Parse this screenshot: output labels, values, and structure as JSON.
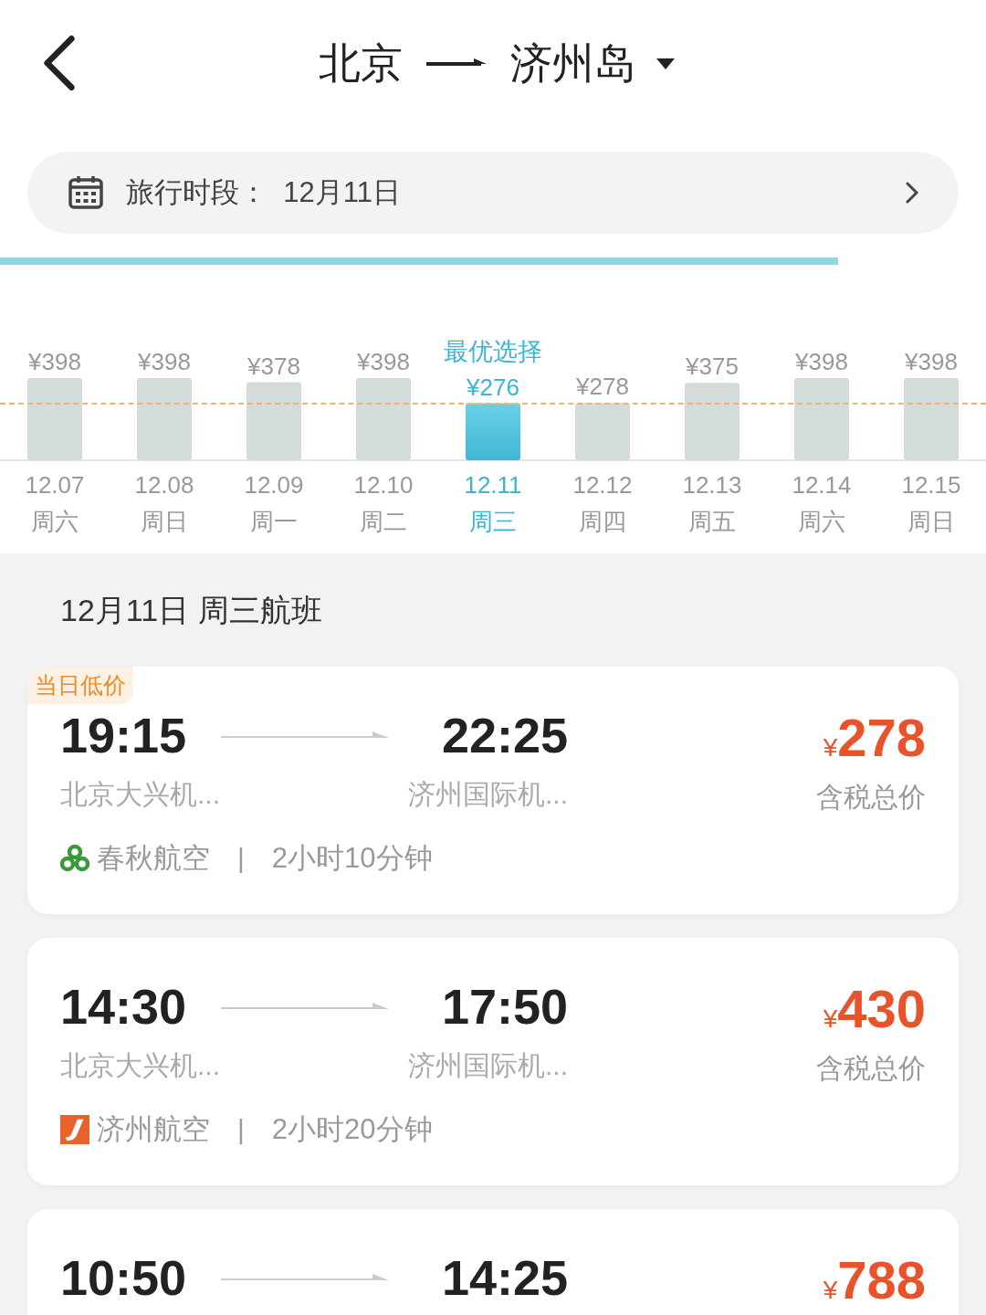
{
  "header": {
    "origin": "北京",
    "destination": "济州岛"
  },
  "date_bar": {
    "label": "旅行时段：",
    "value": "12月11日"
  },
  "loading": {
    "level": 0.85
  },
  "calendar": {
    "chart_data": {
      "type": "bar",
      "categories": [
        "12.07",
        "12.08",
        "12.09",
        "12.10",
        "12.11",
        "12.12",
        "12.13",
        "12.14",
        "12.15"
      ],
      "values": [
        398,
        398,
        378,
        398,
        276,
        278,
        375,
        398,
        398
      ],
      "value_labels": [
        "¥398",
        "¥398",
        "¥378",
        "¥398",
        "¥276",
        "¥278",
        "¥375",
        "¥398",
        "¥398"
      ]
    },
    "days": [
      {
        "weekday": "周六",
        "selected": false
      },
      {
        "weekday": "周日",
        "selected": false
      },
      {
        "weekday": "周一",
        "selected": false
      },
      {
        "weekday": "周二",
        "selected": false
      },
      {
        "weekday": "周三",
        "selected": true,
        "tag": "最优选择"
      },
      {
        "weekday": "周四",
        "selected": false
      },
      {
        "weekday": "周五",
        "selected": false
      },
      {
        "weekday": "周六",
        "selected": false
      },
      {
        "weekday": "周日",
        "selected": false
      }
    ]
  },
  "section_title": "12月11日 周三航班",
  "flights": [
    {
      "badge": "当日低价",
      "depart": "19:15",
      "arrive": "22:25",
      "from": "北京大兴机...",
      "to": "济州国际机...",
      "airline": {
        "kind": "swirl",
        "name": "春秋航空"
      },
      "separator": "|",
      "duration": "2小时10分钟",
      "currency": "¥",
      "price": "278",
      "price_note": "含税总价"
    },
    {
      "depart": "14:30",
      "arrive": "17:50",
      "from": "北京大兴机...",
      "to": "济州国际机...",
      "airline": {
        "kind": "stripe",
        "name": "济州航空"
      },
      "separator": "|",
      "duration": "2小时20分钟",
      "currency": "¥",
      "price": "430",
      "price_note": "含税总价"
    },
    {
      "depart": "10:50",
      "arrive": "14:25",
      "currency": "¥",
      "price": "788"
    }
  ]
}
